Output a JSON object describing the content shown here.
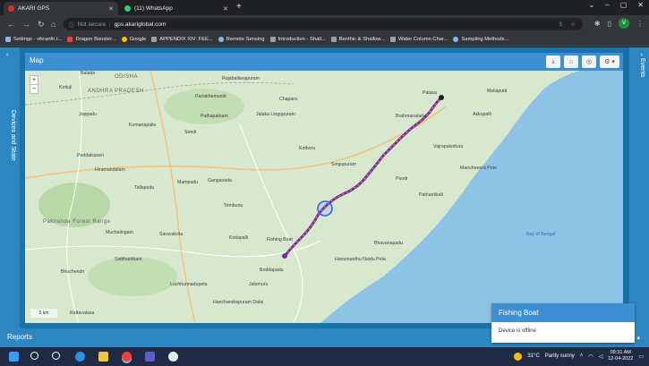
{
  "browser": {
    "tabs": [
      {
        "title": "AKARI GPS",
        "active": true,
        "color": "#d93025"
      },
      {
        "title": "(11) WhatsApp",
        "active": false,
        "color": "#25d366"
      }
    ],
    "new_tab": "+",
    "window_controls": [
      "⌄",
      "–",
      "▢",
      "✕"
    ],
    "security_label": "Not secure",
    "url": "gps.akariglobal.com",
    "profile_letter": "V",
    "bookmarks": [
      {
        "label": "Settings - vikranth.t...",
        "color": "#8ab4f8"
      },
      {
        "label": "Dragon Booster...",
        "color": "#ea4335"
      },
      {
        "label": "Google",
        "color": "#fbbc04"
      },
      {
        "label": "APPENDIX XIV: FEE...",
        "color": "#9aa0a6"
      },
      {
        "label": "Remote Sensing",
        "color": "#8ab4f8"
      },
      {
        "label": "Introduction - Shall...",
        "color": "#9aa0a6"
      },
      {
        "label": "Benthic & Shallow...",
        "color": "#9aa0a6"
      },
      {
        "label": "Water Column Char...",
        "color": "#9aa0a6"
      },
      {
        "label": "Sampling Methods...",
        "color": "#8ab4f8"
      }
    ]
  },
  "app": {
    "left_panel_label": "Devices and State",
    "right_panel_label": "Events",
    "map_title": "Map",
    "map_tools": [
      "⤓",
      "⌂",
      "◎",
      "⚙ ▾"
    ],
    "reports_label": "Reports",
    "popup": {
      "title": "Fishing Boat",
      "status": "Device is offline"
    }
  },
  "map": {
    "zoom_in": "+",
    "zoom_out": "−",
    "scale_text": "5 km",
    "regions": [
      "ODISHA",
      "ANDHRA PRADESH",
      "Paknanda Forest Range"
    ],
    "places": [
      "Balada",
      "Kottuli",
      "Joppadu",
      "Komanapalle",
      "Peddalsaveri",
      "Hiramandalam",
      "Tallapadu",
      "Mampadu",
      "Muchalingam",
      "Saravakota",
      "Bhuchendri",
      "Siddhantham",
      "Parlakhemundi",
      "Pathapatnam",
      "Seedi",
      "Jalaka Lingupuram",
      "Chapara",
      "Kothuru",
      "Singupuram",
      "Rajaballavapuram",
      "Palasa",
      "Meliaputti",
      "Brahmanatarla",
      "Akkupalli",
      "Vajrapukotturu",
      "Mancheeera Pete",
      "Pundi",
      "Patnaekkali",
      "Bhavanapadu",
      "Hanumanthu Naidu Peta",
      "Fishing Boat",
      "Boddapadu",
      "Kotiapalli",
      "Tembunu",
      "Gangavada",
      "Jalumuru",
      "Rattavalasa",
      "Hanchandrapuram Dalai",
      "Lochhunnadupeta"
    ],
    "sea_label": "Bay of Bengal"
  },
  "taskbar": {
    "weather": "31°C",
    "weather_desc": "Partly sunny",
    "time": "09:31 AM",
    "date": "12-04-2022"
  },
  "colors": {
    "accent": "#3d8fd1",
    "track": "#7b2f86",
    "land": "#d7e8cf",
    "sea": "#8ec3e6"
  }
}
